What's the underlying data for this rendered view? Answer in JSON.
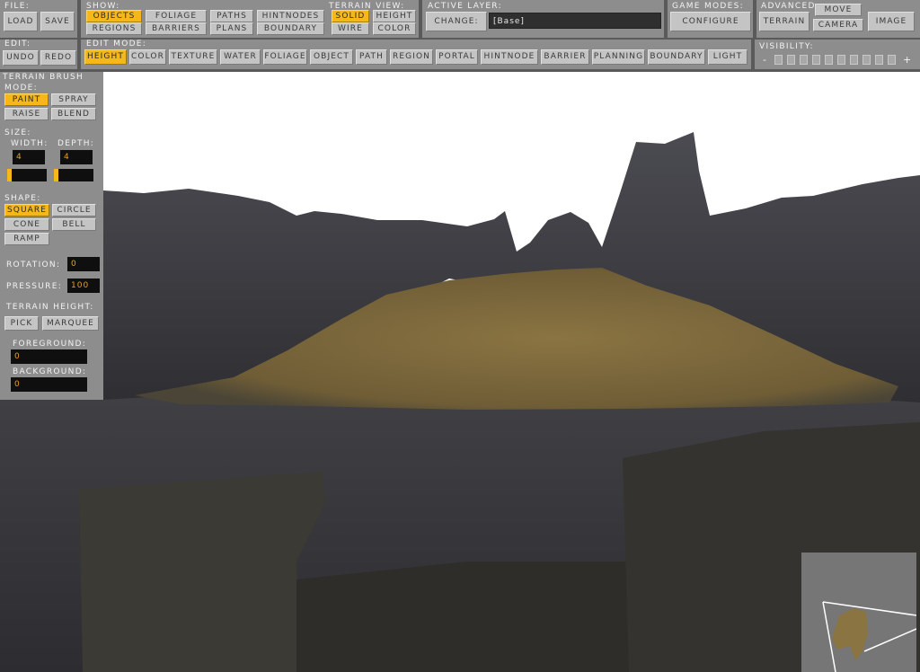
{
  "toolbar": {
    "file": {
      "label": "File:",
      "load": "Load",
      "save": "Save"
    },
    "show": {
      "label": "Show:",
      "objects": "Objects",
      "foliage": "Foliage",
      "paths": "Paths",
      "hintnodes": "HintNodes",
      "regions": "Regions",
      "barriers": "Barriers",
      "plans": "Plans",
      "boundary": "Boundary"
    },
    "terrain_view": {
      "label": "Terrain View:",
      "solid": "Solid",
      "height": "Height",
      "wire": "Wire",
      "color": "Color"
    },
    "active_layer": {
      "label": "Active Layer:",
      "change": "Change:",
      "value": "[Base]"
    },
    "game_modes": {
      "label": "Game Modes:",
      "configure": "Configure"
    },
    "advanced": {
      "label": "Advanced",
      "move": "Move",
      "terrain": "Terrain",
      "camera": "Camera",
      "image": "Image"
    },
    "edit": {
      "label": "Edit:",
      "undo": "Undo",
      "redo": "Redo"
    },
    "edit_mode": {
      "label": "Edit Mode:",
      "height": "Height",
      "color": "Color",
      "texture": "Texture",
      "water": "Water",
      "foliage": "Foliage",
      "object": "Object",
      "path": "Path",
      "region": "Region",
      "portal": "Portal",
      "hintnode": "HintNode",
      "barrier": "Barrier",
      "planning": "Planning",
      "boundary": "Boundary",
      "light": "Light"
    },
    "visibility": {
      "label": "Visibility:",
      "minus": "-",
      "plus": "+"
    }
  },
  "brush": {
    "title": "Terrain Brush",
    "mode_label": "Mode:",
    "paint": "Paint",
    "spray": "Spray",
    "raise": "Raise",
    "blend": "Blend",
    "size_label": "Size:",
    "width_label": "Width:",
    "depth_label": "Depth:",
    "width": "4",
    "depth": "4",
    "shape_label": "Shape:",
    "square": "Square",
    "circle": "Circle",
    "cone": "Cone",
    "bell": "Bell",
    "ramp": "Ramp",
    "rotation_label": "Rotation:",
    "rotation": "0",
    "pressure_label": "Pressure:",
    "pressure": "100",
    "terrain_height_label": "Terrain Height:",
    "pick": "Pick",
    "marquee": "Marquee",
    "foreground_label": "Foreground:",
    "foreground": "0",
    "background_label": "Background:",
    "background": "0"
  },
  "colors": {
    "accent": "#f5b818",
    "panel": "#8d8d8d",
    "sky": "#ffffff",
    "rock": "#47474d",
    "sand": "#8a7442"
  }
}
